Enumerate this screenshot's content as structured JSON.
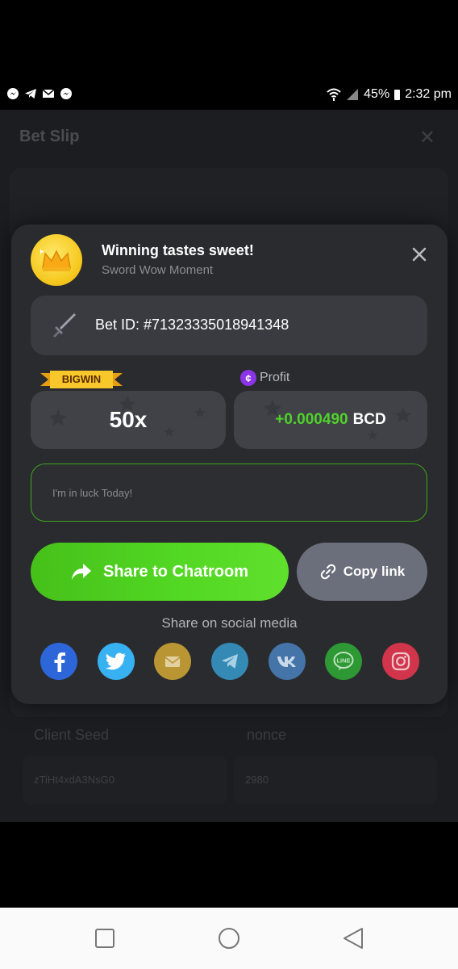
{
  "status_bar": {
    "notification_icons": [
      "messenger-icon",
      "telegram-icon",
      "mail-icon",
      "messenger-icon"
    ],
    "battery": "45%",
    "time": "2:32 pm"
  },
  "background": {
    "title": "Bet Slip",
    "client_seed_label": "Client Seed",
    "nonce_label": "nonce",
    "client_seed_value": "zTiHt4xdA3NsG0",
    "nonce_value": "2980"
  },
  "modal": {
    "title": "Winning tastes sweet!",
    "subtitle": "Sword Wow Moment",
    "bet_id": "Bet ID: #71323335018941348",
    "bigwin_badge": "BIGWIN",
    "profit_label": "Profit",
    "multiplier": "50x",
    "profit_value": "+0.000490",
    "currency": "BCD",
    "message_placeholder": "I'm in luck Today!",
    "share_button": "Share to Chatroom",
    "copy_button": "Copy link",
    "social_label": "Share on social media",
    "social_icons": [
      "facebook-icon",
      "twitter-icon",
      "email-icon",
      "telegram-icon",
      "vk-icon",
      "line-icon",
      "instagram-icon"
    ]
  },
  "colors": {
    "accent_green": "#4fd12b",
    "modal_bg": "#2a2b2f",
    "facebook": "#2d66d8",
    "twitter": "#37b1f1",
    "email": "#b99633",
    "telegram": "#3489b5",
    "vk": "#4474a8",
    "line": "#2e9934",
    "instagram": "#d0354b"
  }
}
